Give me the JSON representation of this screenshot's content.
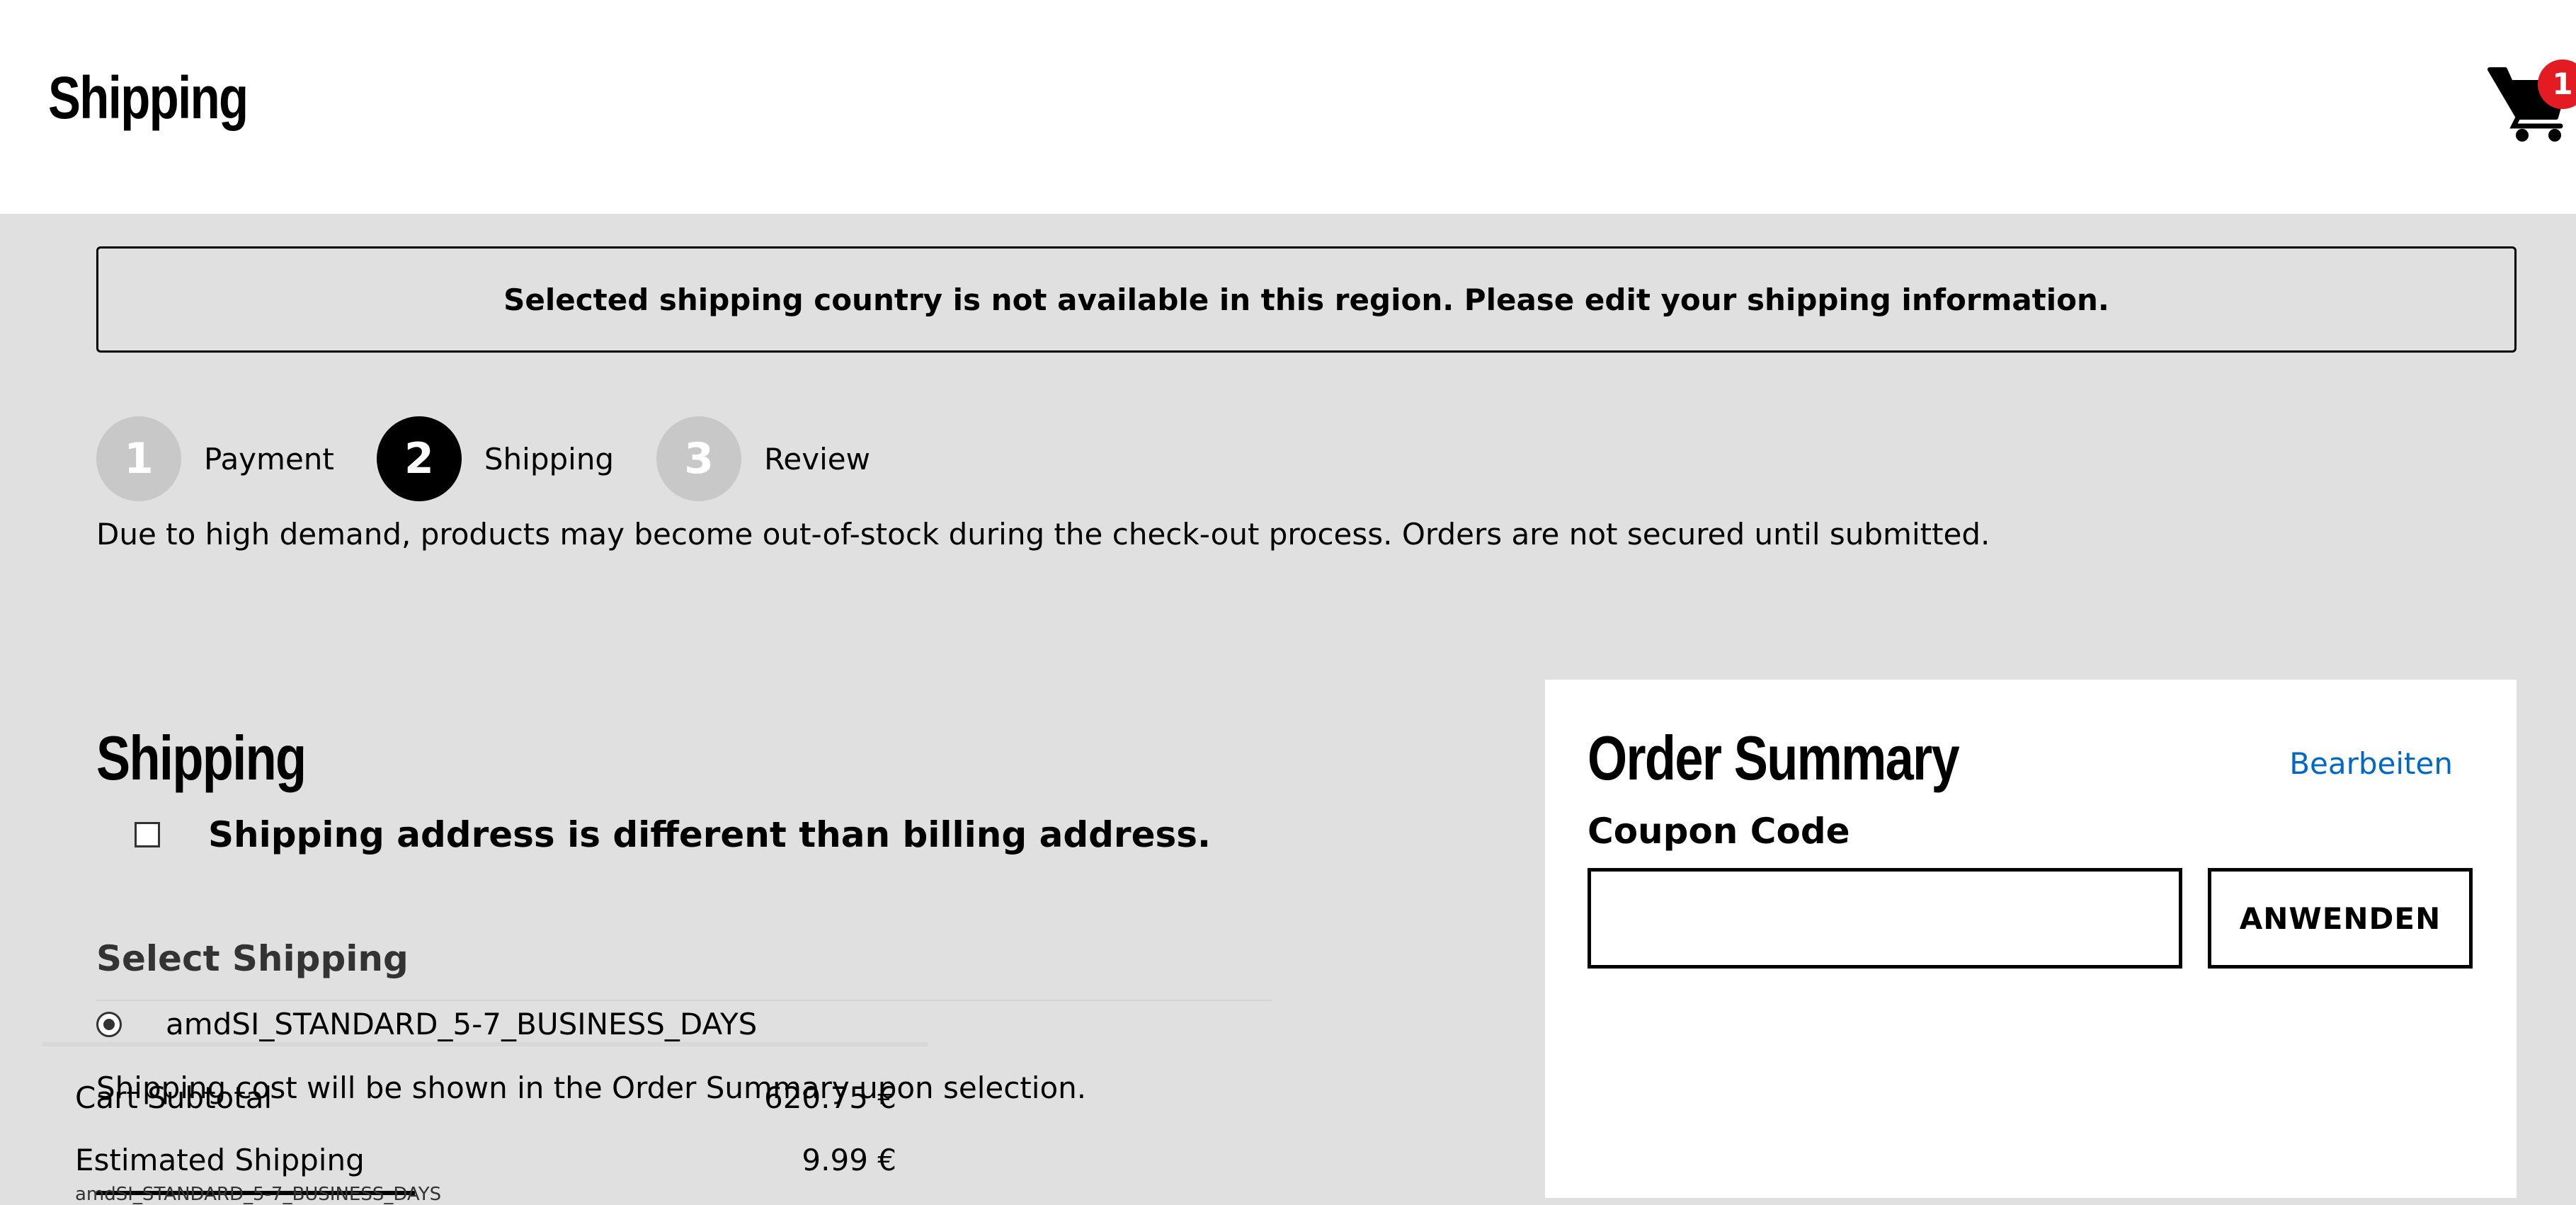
{
  "header": {
    "title": "Shipping",
    "cart_count": "1"
  },
  "alert": {
    "message": "Selected shipping country is not available in this region. Please edit your shipping information."
  },
  "steps": [
    {
      "number": "1",
      "label": "Payment",
      "active": false
    },
    {
      "number": "2",
      "label": "Shipping",
      "active": true
    },
    {
      "number": "3",
      "label": "Review",
      "active": false
    }
  ],
  "notice": "Due to high demand, products may become out-of-stock during the check-out process. Orders are not secured until submitted.",
  "shipping": {
    "title": "Shipping",
    "different_address_label": "Shipping address is different than billing address.",
    "different_address_checked": false,
    "select_title": "Select Shipping",
    "method_label": "amdSI_STANDARD_5-7_BUSINESS_DAYS",
    "method_selected": true,
    "cost_note": "Shipping cost will be shown in the Order Summary upon selection."
  },
  "summary": {
    "title": "Order Summary",
    "edit_label": "Bearbeiten",
    "coupon_label": "Coupon Code",
    "coupon_value": "",
    "apply_label": "ANWENDEN",
    "subtotal_label": "Cart Subtotal",
    "subtotal_value": "620.75 €",
    "shipping_label": "Estimated Shipping",
    "shipping_value": "9.99 €",
    "shipping_method": "amdSI_STANDARD_5-7_BUSINESS_DAYS"
  },
  "colors": {
    "page_background": "#e0e0e0",
    "badge": "#e31b23",
    "link": "#0068c9",
    "step_inactive": "#c8c8c8",
    "step_active": "#000000"
  },
  "icons": {
    "cart": "shopping-cart-icon"
  }
}
